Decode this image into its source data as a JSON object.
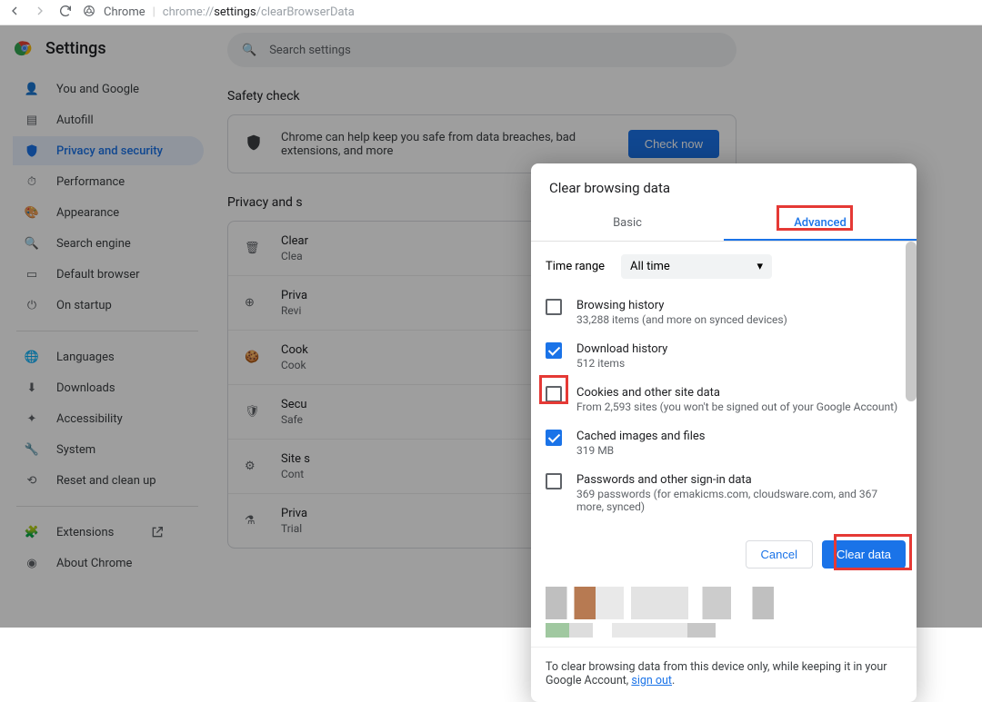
{
  "browser": {
    "product": "Chrome",
    "url_prefix": "chrome://",
    "url_bold": "settings",
    "url_rest": "/clearBrowserData"
  },
  "header": {
    "title": "Settings"
  },
  "search": {
    "placeholder": "Search settings"
  },
  "nav": {
    "you": "You and Google",
    "autofill": "Autofill",
    "privacy": "Privacy and security",
    "performance": "Performance",
    "appearance": "Appearance",
    "search": "Search engine",
    "default_browser": "Default browser",
    "startup": "On startup",
    "languages": "Languages",
    "downloads": "Downloads",
    "accessibility": "Accessibility",
    "system": "System",
    "reset": "Reset and clean up",
    "extensions": "Extensions",
    "about": "About Chrome"
  },
  "safety": {
    "heading": "Safety check",
    "text": "Chrome can help keep you safe from data breaches, bad extensions, and more",
    "button": "Check now"
  },
  "privacy_section": {
    "heading": "Privacy and s"
  },
  "ps_rows": {
    "r1t": "Clear",
    "r1s": "Clea",
    "r2t": "Priva",
    "r2s": "Revi",
    "r3t": "Cook",
    "r3s": "Cook",
    "r4t": "Secu",
    "r4s": "Safe",
    "r5t": "Site s",
    "r5s": "Cont",
    "r6t": "Priva",
    "r6s": "Trial"
  },
  "dialog": {
    "title": "Clear browsing data",
    "tab_basic": "Basic",
    "tab_advanced": "Advanced",
    "time_label": "Time range",
    "time_value": "All time",
    "items": {
      "history_t": "Browsing history",
      "history_s": "33,288 items (and more on synced devices)",
      "download_t": "Download history",
      "download_s": "512 items",
      "cookies_t": "Cookies and other site data",
      "cookies_s": "From 2,593 sites (you won't be signed out of your Google Account)",
      "cache_t": "Cached images and files",
      "cache_s": "319 MB",
      "passwords_t": "Passwords and other sign-in data",
      "passwords_s": "369 passwords (for emakicms.com, cloudsware.com, and 367 more, synced)"
    },
    "cancel": "Cancel",
    "clear": "Clear data",
    "footer_text": "To clear browsing data from this device only, while keeping it in your Google Account, ",
    "signout": "sign out",
    "footer_period": "."
  },
  "checkbox_state": {
    "history": false,
    "download": true,
    "cookies": false,
    "cache": true,
    "passwords": false
  }
}
